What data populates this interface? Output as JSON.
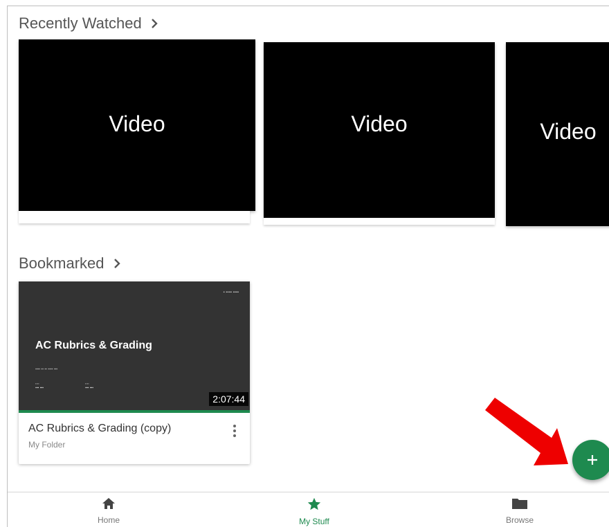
{
  "recently_watched": {
    "title": "Recently Watched",
    "videos": [
      {
        "label": "Video"
      },
      {
        "label": "Video"
      },
      {
        "label": "Video"
      }
    ]
  },
  "bookmarked": {
    "title": "Bookmarked",
    "items": [
      {
        "thumbnail_title": "AC Rubrics & Grading",
        "duration": "2:07:44",
        "title": "AC Rubrics & Grading (copy)",
        "folder": "My Folder"
      }
    ]
  },
  "colors": {
    "accent": "#1e8a4f",
    "arrow": "#ee0000",
    "thumbnail_bg": "#333333"
  },
  "bottom_nav": {
    "items": [
      {
        "label": "Home",
        "icon": "home-icon"
      },
      {
        "label": "My Stuff",
        "icon": "star-icon",
        "active": true
      },
      {
        "label": "Browse",
        "icon": "folder-icon"
      }
    ]
  }
}
